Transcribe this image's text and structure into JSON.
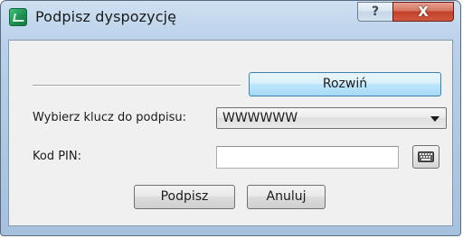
{
  "window": {
    "title": "Podpisz dyspozycję",
    "help_label": "?",
    "close_label": "X"
  },
  "expand_button": {
    "label": "Rozwiń"
  },
  "key_select": {
    "label": "Wybierz klucz do podpisu:",
    "value": "WWWWWW"
  },
  "pin": {
    "label": "Kod PIN:",
    "value": "",
    "keyboard_icon": "keyboard-icon"
  },
  "buttons": {
    "sign_label": "Podpisz",
    "cancel_label": "Anuluj"
  },
  "colors": {
    "titlebar": "#b9d1ea",
    "close_button": "#c2412b",
    "client_background": "#f0f0f0",
    "default_button_border": "#3c7fb1"
  }
}
